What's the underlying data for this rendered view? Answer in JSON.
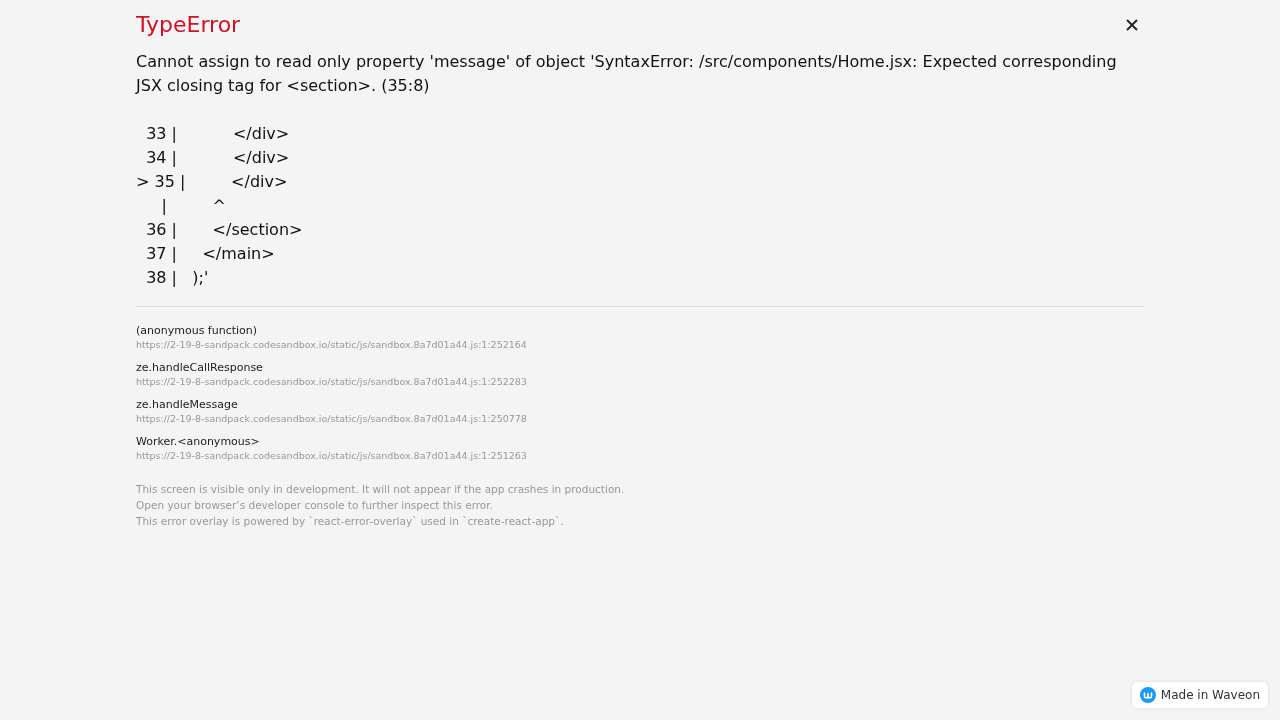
{
  "error": {
    "title": "TypeError",
    "message": "Cannot assign to read only property 'message' of object 'SyntaxError: /src/components/Home.jsx: Expected corresponding JSX closing tag for <section>. (35:8)",
    "code_lines": [
      "  33 |           </div>",
      "  34 |           </div>",
      "> 35 |         </div>",
      "     |         ^",
      "  36 |       </section>",
      "  37 |     </main>",
      "  38 |   );'"
    ]
  },
  "stack_frames": [
    {
      "function": "(anonymous function)",
      "location": "https://2-19-8-sandpack.codesandbox.io/static/js/sandbox.8a7d01a44.js:1:252164"
    },
    {
      "function": "ze.handleCallResponse",
      "location": "https://2-19-8-sandpack.codesandbox.io/static/js/sandbox.8a7d01a44.js:1:252283"
    },
    {
      "function": "ze.handleMessage",
      "location": "https://2-19-8-sandpack.codesandbox.io/static/js/sandbox.8a7d01a44.js:1:250778"
    },
    {
      "function": "Worker.<anonymous>",
      "location": "https://2-19-8-sandpack.codesandbox.io/static/js/sandbox.8a7d01a44.js:1:251263"
    }
  ],
  "footer_lines": [
    "This screen is visible only in development. It will not appear if the app crashes in production.",
    "Open your browser’s developer console to further inspect this error.",
    "This error overlay is powered by `react-error-overlay` used in `create-react-app`."
  ],
  "badge": {
    "label": "Made in Waveon"
  }
}
